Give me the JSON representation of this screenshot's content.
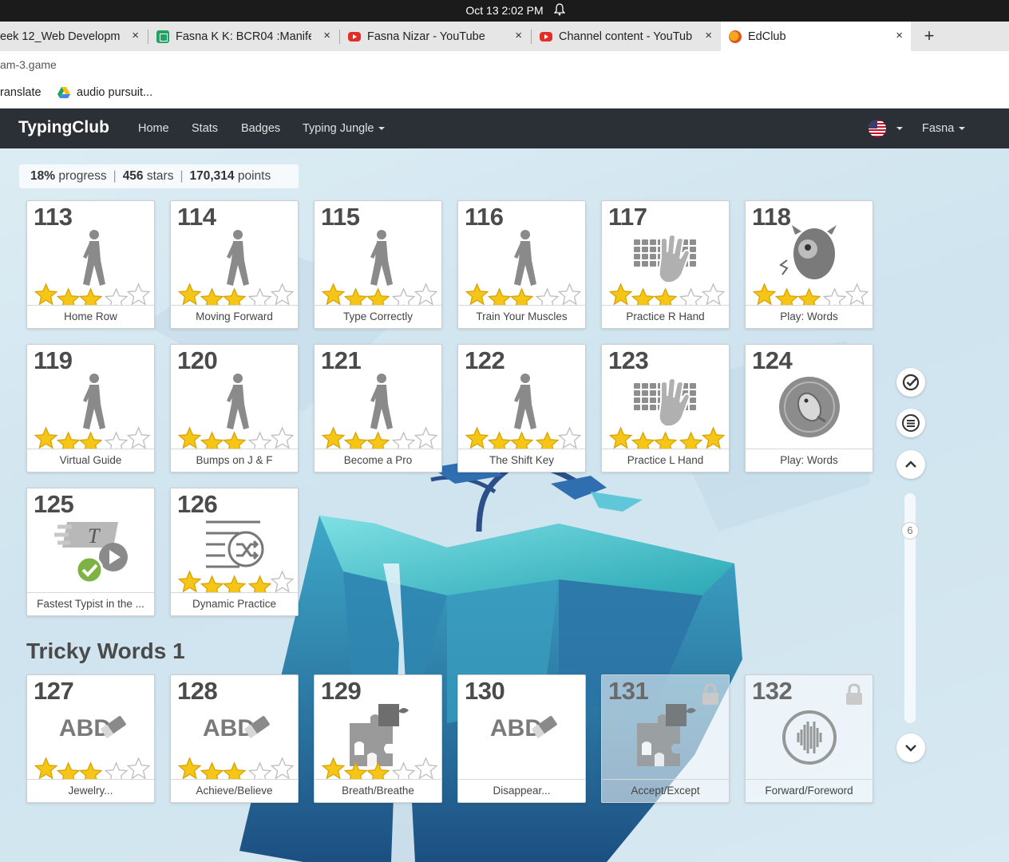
{
  "os": {
    "clock": "Oct 13  2:02 PM"
  },
  "browser": {
    "tabs": [
      {
        "label": "eek 12_Web Developme",
        "favicon": "none",
        "active": false
      },
      {
        "label": "Fasna K K: BCR04 :Manife",
        "favicon": "sheets-icon",
        "active": false
      },
      {
        "label": "Fasna Nizar - YouTube",
        "favicon": "youtube-icon",
        "active": false
      },
      {
        "label": "Channel content - YouTub",
        "favicon": "youtube-icon",
        "active": false
      },
      {
        "label": "EdClub",
        "favicon": "edclub-icon",
        "active": true
      }
    ],
    "close_glyph": "×",
    "new_tab": "+",
    "url": "am-3.game",
    "bookmarks": [
      {
        "label": "ranslate"
      },
      {
        "label": "audio pursuit..."
      }
    ]
  },
  "nav": {
    "brand": "TypingClub",
    "links": [
      "Home",
      "Stats",
      "Badges",
      "Typing Jungle"
    ],
    "user": "Fasna"
  },
  "progress": {
    "percent": "18%",
    "percent_label": "progress",
    "stars": "456",
    "stars_label": "stars",
    "points": "170,314",
    "points_label": "points",
    "sep": "|"
  },
  "lessons": [
    {
      "num": "113",
      "title": "Home Row",
      "icon": "walker-icon",
      "stars": 3,
      "locked": false
    },
    {
      "num": "114",
      "title": "Moving Forward",
      "icon": "walker-icon",
      "stars": 3,
      "locked": false
    },
    {
      "num": "115",
      "title": "Type Correctly",
      "icon": "walker-icon",
      "stars": 3,
      "locked": false
    },
    {
      "num": "116",
      "title": "Train Your Muscles",
      "icon": "walker-icon",
      "stars": 3,
      "locked": false
    },
    {
      "num": "117",
      "title": "Practice R Hand",
      "icon": "keyboard-hand-icon",
      "stars": 3,
      "locked": false
    },
    {
      "num": "118",
      "title": "Play: Words",
      "icon": "monster-icon",
      "stars": 3,
      "locked": false
    },
    {
      "num": "119",
      "title": "Virtual Guide",
      "icon": "walker-icon",
      "stars": 3,
      "locked": false
    },
    {
      "num": "120",
      "title": "Bumps on J & F",
      "icon": "walker-icon",
      "stars": 3,
      "locked": false
    },
    {
      "num": "121",
      "title": "Become a Pro",
      "icon": "walker-icon",
      "stars": 3,
      "locked": false
    },
    {
      "num": "122",
      "title": "The Shift Key",
      "icon": "walker-icon",
      "stars": 4,
      "locked": false
    },
    {
      "num": "123",
      "title": "Practice L Hand",
      "icon": "keyboard-hand-icon",
      "stars": 5,
      "locked": false
    },
    {
      "num": "124",
      "title": "Play: Words",
      "icon": "penguin-disc-icon",
      "stars": 0,
      "locked": false
    },
    {
      "num": "125",
      "title": "Fastest Typist in the ...",
      "icon": "fast-typist-check-icon",
      "stars": 0,
      "locked": false
    },
    {
      "num": "126",
      "title": "Dynamic Practice",
      "icon": "shuffle-list-icon",
      "stars": 4,
      "locked": false
    }
  ],
  "section": {
    "title": "Tricky Words 1"
  },
  "tricky": [
    {
      "num": "127",
      "title": "Jewelry...",
      "icon": "abc-eraser-icon",
      "art_text": "ABD",
      "stars": 3,
      "locked": false
    },
    {
      "num": "128",
      "title": "Achieve/Believe",
      "icon": "abc-eraser-icon",
      "art_text": "ABD",
      "stars": 3,
      "locked": false
    },
    {
      "num": "129",
      "title": "Breath/Breathe",
      "icon": "puzzle-icon",
      "stars": 3,
      "locked": false
    },
    {
      "num": "130",
      "title": "Disappear...",
      "icon": "abc-eraser-icon",
      "art_text": "ABD",
      "stars": 0,
      "locked": false
    },
    {
      "num": "131",
      "title": "Accept/Except",
      "icon": "puzzle-icon",
      "stars": 0,
      "locked": true
    },
    {
      "num": "132",
      "title": "Forward/Foreword",
      "icon": "audio-wave-icon",
      "stars": 0,
      "locked": true
    }
  ],
  "rail": {
    "page_number": "6"
  },
  "colors": {
    "nav_bg": "#2b2f36",
    "star": "#f5c518",
    "card_text": "#4b4b4b"
  }
}
